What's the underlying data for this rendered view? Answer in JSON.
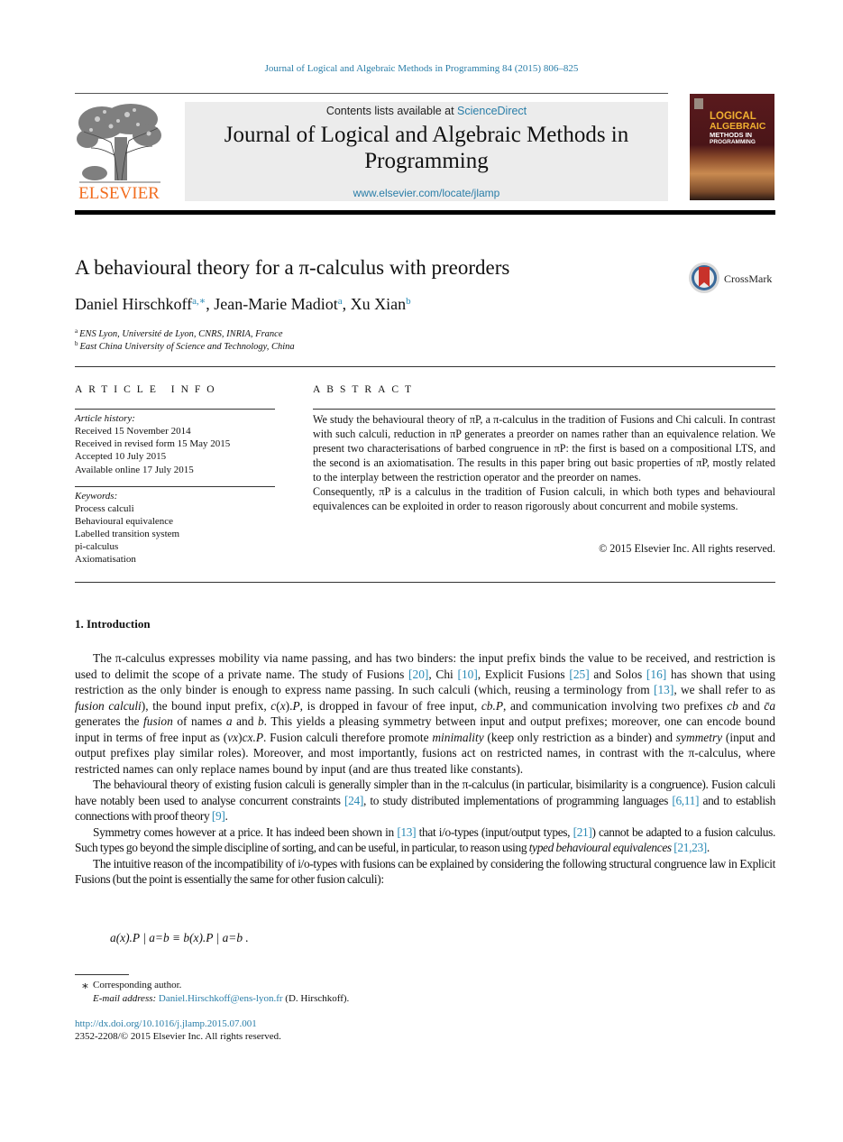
{
  "running_header": "Journal of Logical and Algebraic Methods in Programming 84 (2015) 806–825",
  "publisher": {
    "logo_icon": "elsevier-tree-icon",
    "name": "ELSEVIER"
  },
  "banner": {
    "contents_prefix": "Contents lists available at ",
    "contents_link": "ScienceDirect",
    "journal_title_line1": "Journal of Logical and Algebraic Methods in",
    "journal_title_line2": "Programming",
    "journal_url": "www.elsevier.com/locate/jlamp"
  },
  "cover": {
    "line1": "LOGICAL",
    "line2": "ALGEBRAIC",
    "line3": "METHODS IN",
    "line4": "PROGRAMMING"
  },
  "article": {
    "title": "A behavioural theory for a π-calculus with preorders",
    "crossmark_label": "CrossMark",
    "authors": [
      {
        "name": "Daniel Hirschkoff",
        "sup": "a,∗"
      },
      {
        "name": "Jean-Marie Madiot",
        "sup": "a"
      },
      {
        "name": "Xu Xian",
        "sup": "b"
      }
    ],
    "affiliations": [
      {
        "key": "a",
        "text": "ENS Lyon, Université de Lyon, CNRS, INRIA, France"
      },
      {
        "key": "b",
        "text": "East China University of Science and Technology, China"
      }
    ]
  },
  "article_info": {
    "heading": "ARTICLE INFO",
    "history_label": "Article history:",
    "history": [
      "Received 15 November 2014",
      "Received in revised form 15 May 2015",
      "Accepted 10 July 2015",
      "Available online 17 July 2015"
    ],
    "keywords_label": "Keywords:",
    "keywords": [
      "Process calculi",
      "Behavioural equivalence",
      "Labelled transition system",
      "pi-calculus",
      "Axiomatisation"
    ]
  },
  "abstract": {
    "heading": "ABSTRACT",
    "paragraph1": "We study the behavioural theory of πP, a π-calculus in the tradition of Fusions and Chi calculi. In contrast with such calculi, reduction in πP generates a preorder on names rather than an equivalence relation. We present two characterisations of barbed congruence in πP: the first is based on a compositional LTS, and the second is an axiomatisation. The results in this paper bring out basic properties of πP, mostly related to the interplay between the restriction operator and the preorder on names.",
    "paragraph2": "Consequently, πP is a calculus in the tradition of Fusion calculi, in which both types and behavioural equivalences can be exploited in order to reason rigorously about concurrent and mobile systems.",
    "copyright": "© 2015 Elsevier Inc. All rights reserved."
  },
  "intro": {
    "heading": "1.  Introduction",
    "p1": [
      {
        "t": "The π-calculus expresses mobility via name passing, and has two binders: the input prefix binds the value to be received, and restriction is used to delimit the scope of a private name. The study of Fusions "
      },
      {
        "c": "[20]"
      },
      {
        "t": ", Chi "
      },
      {
        "c": "[10]"
      },
      {
        "t": ", Explicit Fusions "
      },
      {
        "c": "[25]"
      },
      {
        "t": " and Solos "
      },
      {
        "c": "[16]"
      },
      {
        "t": " has shown that using restriction as the only binder is enough to express name passing. In such calculi (which, reusing a terminology from "
      },
      {
        "c": "[13]"
      },
      {
        "t": ", we shall refer to as "
      },
      {
        "i": "fusion calculi"
      },
      {
        "t": "), the bound input prefix, "
      },
      {
        "i": "c"
      },
      {
        "t": "("
      },
      {
        "i": "x"
      },
      {
        "t": ")."
      },
      {
        "i": "P"
      },
      {
        "t": ", is dropped in favour of free input, "
      },
      {
        "i": "cb.P"
      },
      {
        "t": ", and communication involving two prefixes "
      },
      {
        "i": "cb"
      },
      {
        "t": " and "
      },
      {
        "i": "c̄a"
      },
      {
        "t": " generates the "
      },
      {
        "i": "fusion"
      },
      {
        "t": " of names "
      },
      {
        "i": "a"
      },
      {
        "t": " and "
      },
      {
        "i": "b"
      },
      {
        "t": ". This yields a pleasing symmetry between input and output prefixes; moreover, one can encode bound input in terms of free input as ("
      },
      {
        "i": "νx"
      },
      {
        "t": ")"
      },
      {
        "i": "cx.P"
      },
      {
        "t": ". Fusion calculi therefore promote "
      },
      {
        "i": "minimality"
      },
      {
        "t": " (keep only restriction as a binder) and "
      },
      {
        "i": "symmetry"
      },
      {
        "t": " (input and output prefixes play similar roles). Moreover, and most importantly, fusions act on restricted names, in contrast with the π-calculus, where restricted names can only replace names bound by input (and are thus treated like constants)."
      }
    ],
    "p2": [
      {
        "t": "The behavioural theory of existing fusion calculi is generally simpler than in the π-calculus (in particular, bisimilarity is a congruence). Fusion calculi have notably been used to analyse concurrent constraints "
      },
      {
        "c": "[24]"
      },
      {
        "t": ", to study distributed implementations of programming languages "
      },
      {
        "c": "[6,11]"
      },
      {
        "t": " and to establish connections with proof theory "
      },
      {
        "c": "[9]"
      },
      {
        "t": "."
      }
    ],
    "p3": [
      {
        "t": "Symmetry comes however at a price. It has indeed been shown in "
      },
      {
        "c": "[13]"
      },
      {
        "t": " that i/o-types (input/output types, "
      },
      {
        "c": "[21]"
      },
      {
        "t": ") cannot be adapted to a fusion calculus. Such types go beyond the simple discipline of sorting, and can be useful, in particular, to reason using "
      },
      {
        "i": "typed behavioural equivalences"
      },
      {
        "t": " "
      },
      {
        "c": "[21,23]"
      },
      {
        "t": "."
      }
    ],
    "p4": [
      {
        "t": "The intuitive reason of the incompatibility of i/o-types with fusions can be explained by considering the following structural congruence law in Explicit Fusions (but the point is essentially the same for other fusion calculi):"
      }
    ],
    "formula": "a(x).P | a=b ≡ b(x).P | a=b ."
  },
  "footnotes": {
    "star": "∗",
    "corresponding": "Corresponding author.",
    "email_label": "E-mail address:",
    "email": "Daniel.Hirschkoff@ens-lyon.fr",
    "email_suffix": " (D. Hirschkoff).",
    "doi": "http://dx.doi.org/10.1016/j.jlamp.2015.07.001",
    "issn": "2352-2208/© 2015 Elsevier Inc. All rights reserved."
  }
}
